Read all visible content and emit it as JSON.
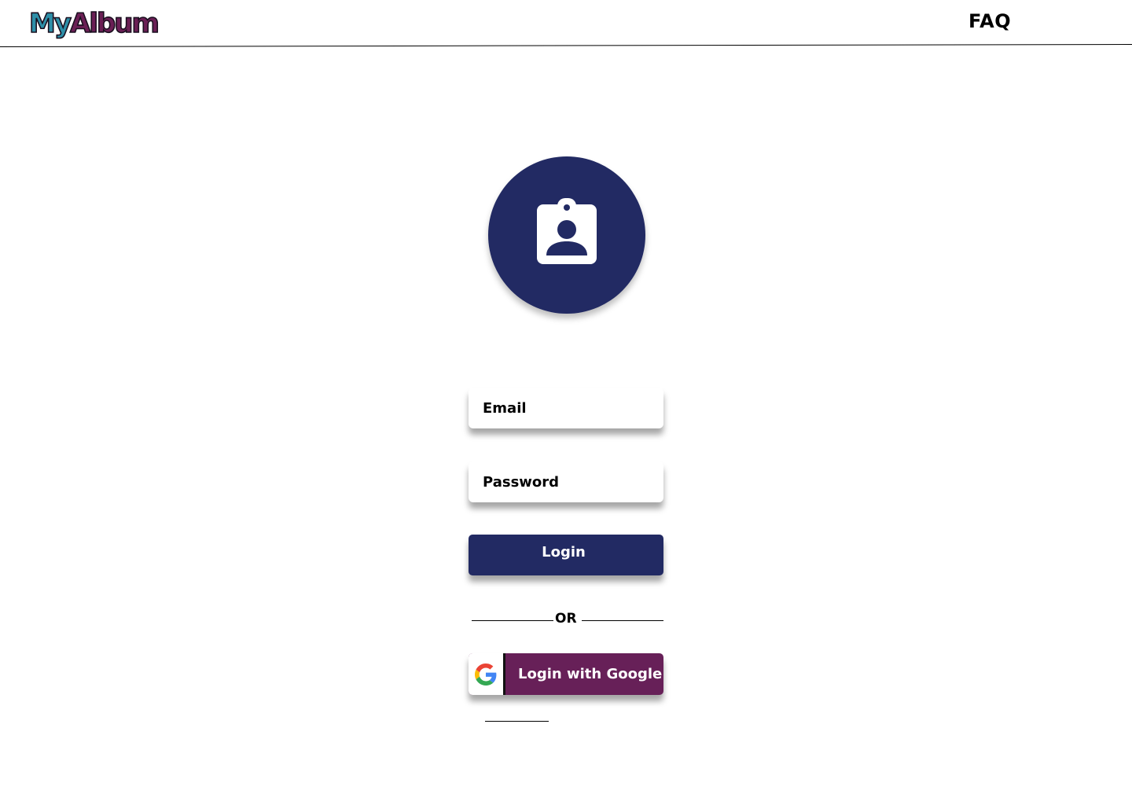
{
  "header": {
    "logo_part1": "My",
    "logo_part2": "Album",
    "faq_label": "FAQ"
  },
  "avatar": {
    "icon": "badge-icon"
  },
  "form": {
    "email_placeholder": "Email",
    "password_placeholder": "Password",
    "login_label": "Login",
    "divider_text": "OR",
    "google_label": "Login with Google",
    "google_icon": "google-icon"
  },
  "colors": {
    "navy": "#222a63",
    "plum": "#672058",
    "teal": "#2e8fa8",
    "white": "#ffffff",
    "black": "#000000"
  }
}
